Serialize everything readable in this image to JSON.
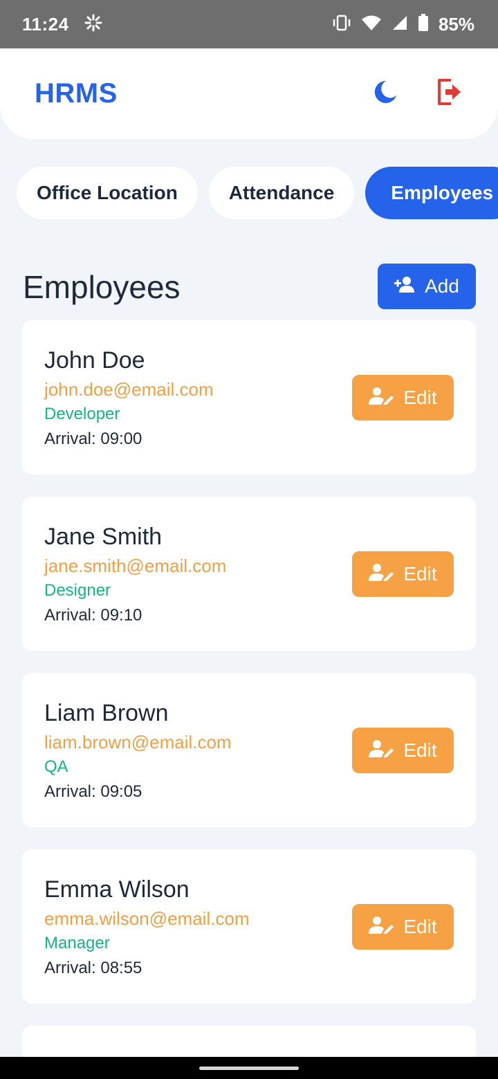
{
  "status_bar": {
    "time": "11:24",
    "battery": "85%",
    "icons": [
      "settings-spinner-icon",
      "vibrate-icon",
      "wifi-icon",
      "signal-icon",
      "battery-icon"
    ]
  },
  "app": {
    "title": "HRMS",
    "brand_color": "#2563eb",
    "actions": [
      "moon-icon",
      "logout-icon"
    ]
  },
  "tabs": [
    {
      "label": "Office Location",
      "active": false
    },
    {
      "label": "Attendance",
      "active": false
    },
    {
      "label": "Employees",
      "active": true
    }
  ],
  "section": {
    "title": "Employees",
    "add_label": "Add"
  },
  "employees": [
    {
      "name": "John Doe",
      "email": "john.doe@email.com",
      "role": "Developer",
      "arrival": "Arrival: 09:00",
      "edit_label": "Edit"
    },
    {
      "name": "Jane Smith",
      "email": "jane.smith@email.com",
      "role": "Designer",
      "arrival": "Arrival: 09:10",
      "edit_label": "Edit"
    },
    {
      "name": "Liam Brown",
      "email": "liam.brown@email.com",
      "role": "QA",
      "arrival": "Arrival: 09:05",
      "edit_label": "Edit"
    },
    {
      "name": "Emma Wilson",
      "email": "emma.wilson@email.com",
      "role": "Manager",
      "arrival": "Arrival: 08:55",
      "edit_label": "Edit"
    }
  ],
  "colors": {
    "accent": "#2563eb",
    "email": "#f59e42",
    "role": "#10b981",
    "edit_button": "#f6a144",
    "logout": "#e53935"
  }
}
